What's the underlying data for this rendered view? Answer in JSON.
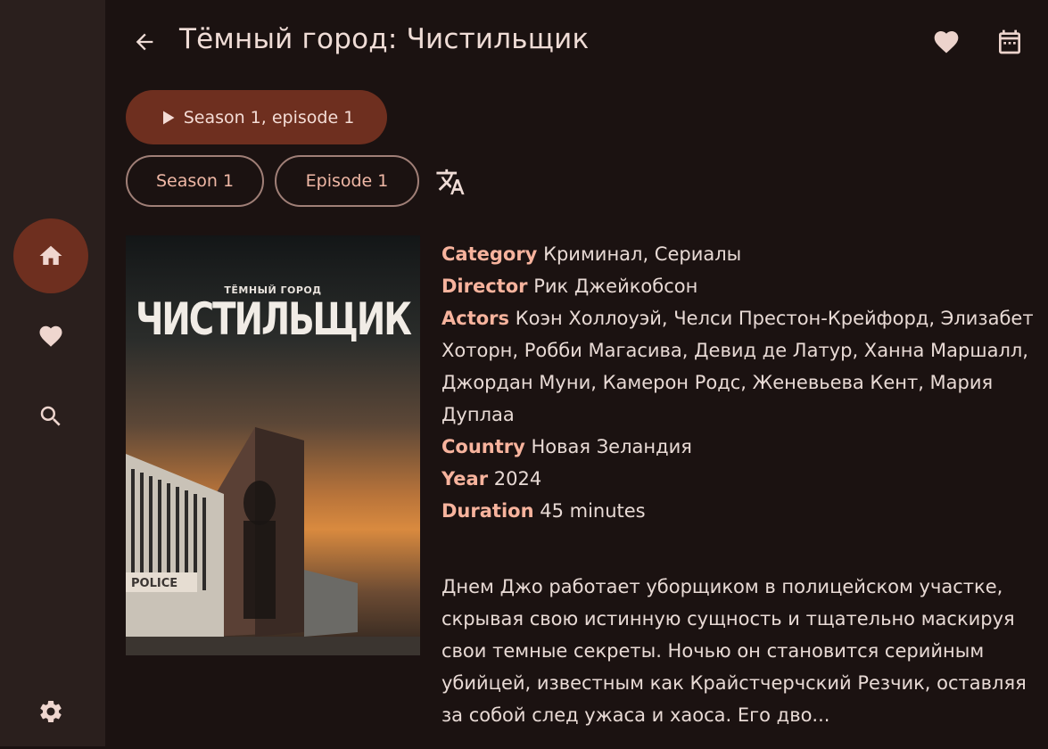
{
  "nav": {
    "items": [
      {
        "name": "home",
        "icon": "home-icon",
        "active": true
      },
      {
        "name": "favorites",
        "icon": "heart-icon",
        "active": false
      },
      {
        "name": "search",
        "icon": "search-icon",
        "active": false
      }
    ],
    "settings_icon": "gear-icon"
  },
  "header": {
    "title": "Тёмный город: Чистильщик",
    "back_icon": "arrow-back-icon",
    "favorite_icon": "heart-icon",
    "calendar_icon": "calendar-icon"
  },
  "actions": {
    "play_label": "Season 1, episode 1",
    "season_chip": "Season 1",
    "episode_chip": "Episode 1",
    "translate_icon": "translate-icon"
  },
  "poster": {
    "small_title": "ТЁМНЫЙ ГОРОД",
    "big_title": "ЧИСТИЛЬЩИК",
    "sign_text": "POLICE"
  },
  "details": {
    "category_label": "Category",
    "category_value": "Криминал, Сериалы",
    "director_label": "Director",
    "director_value": "Рик Джейкобсон",
    "actors_label": "Actors",
    "actors_value": "Коэн Холлоуэй, Челси Престон-Крейфорд, Элизабет Хоторн, Робби Магасива, Девид де Латур, Ханна Маршалл, Джордан Муни, Камерон Родс, Женевьева Кент, Мария Дуплаа",
    "country_label": "Country",
    "country_value": "Новая Зеландия",
    "year_label": "Year",
    "year_value": "2024",
    "duration_label": "Duration",
    "duration_value": "45 minutes"
  },
  "description": "Днем Джо работает уборщиком в полицейском участке, скрывая свою истинную сущность и тщательно маскируя свои темные секреты. Ночью он становится серийным убийцей, известным как Крайстчерчский Резчик, оставляя за собой след ужаса и хаоса. Его дво...",
  "colors": {
    "background": "#1b1211",
    "rail": "#2a1f1d",
    "accent": "#6e2f1f",
    "label": "#f7b39d",
    "chip_text": "#f0b8a6"
  }
}
